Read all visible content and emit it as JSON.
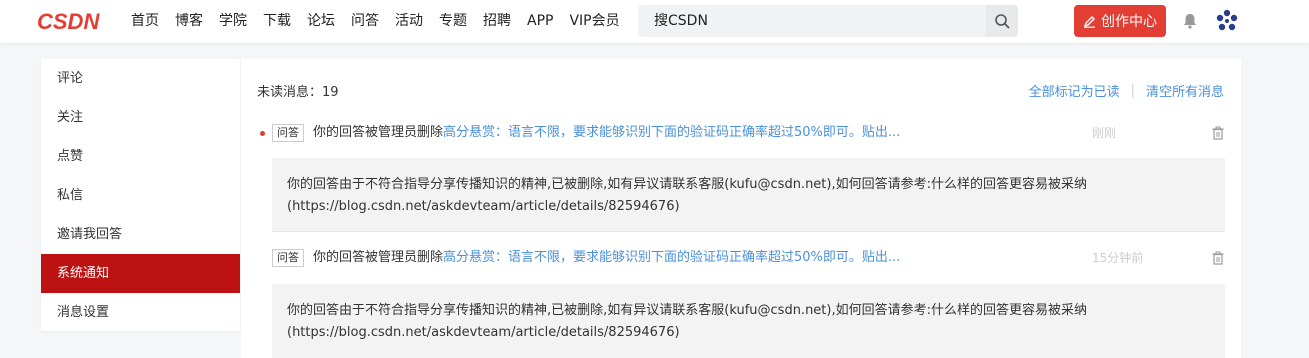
{
  "header": {
    "logo_text": "CSDN",
    "nav": [
      "首页",
      "博客",
      "学院",
      "下载",
      "论坛",
      "问答",
      "活动",
      "专题",
      "招聘",
      "APP",
      "VIP会员"
    ],
    "search_placeholder": "搜CSDN",
    "create_label": "创作中心",
    "brand_color": "#e33e33"
  },
  "sidebar": {
    "items": [
      {
        "label": "评论"
      },
      {
        "label": "关注"
      },
      {
        "label": "点赞"
      },
      {
        "label": "私信"
      },
      {
        "label": "邀请我回答"
      },
      {
        "label": "系统通知",
        "active": true
      },
      {
        "label": "消息设置"
      }
    ],
    "active_color": "#bc1212"
  },
  "main": {
    "unread_label": "未读消息：19",
    "mark_all_read": "全部标记为已读",
    "separator": "|",
    "clear_all": "清空所有消息",
    "messages": [
      {
        "unread": true,
        "tag": "问答",
        "prefix": "你的回答被管理员删除",
        "link": "高分悬赏：语言不限，要求能够识别下面的验证码正确率超过50%即可。贴出...",
        "time": "刚刚",
        "body": "你的回答由于不符合指导分享传播知识的精神,已被删除,如有异议请联系客服(kufu@csdn.net),如何回答请参考:什么样的回答更容易被采纳(https://blog.csdn.net/askdevteam/article/details/82594676)"
      },
      {
        "unread": false,
        "tag": "问答",
        "prefix": "你的回答被管理员删除",
        "link": "高分悬赏：语言不限，要求能够识别下面的验证码正确率超过50%即可。贴出...",
        "time": "15分钟前",
        "body": "你的回答由于不符合指导分享传播知识的精神,已被删除,如有异议请联系客服(kufu@csdn.net),如何回答请参考:什么样的回答更容易被采纳(https://blog.csdn.net/askdevteam/article/details/82594676)"
      }
    ]
  }
}
